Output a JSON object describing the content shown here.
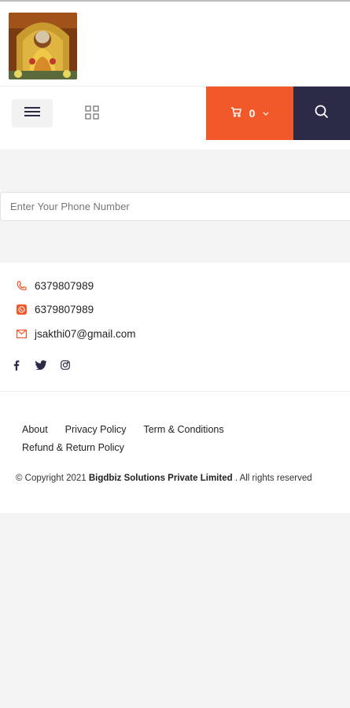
{
  "header": {
    "logo_alt": "Temple deity logo",
    "cart_count": "0"
  },
  "icons": {
    "menu": "hamburger-icon",
    "grid": "grid-icon",
    "cart": "cart-icon",
    "dropdown": "chevron-down-icon",
    "search": "search-icon"
  },
  "colors": {
    "cart_bg": "#f2592a",
    "search_bg": "#2b2b47",
    "accent": "#f2592a"
  },
  "subscribe": {
    "placeholder": "Enter Your Phone Number"
  },
  "contact": {
    "phone": "6379807989",
    "whatsapp": "6379807989",
    "email": "jsakthi07@gmail.com"
  },
  "social": [
    "facebook-icon",
    "twitter-icon",
    "instagram-icon"
  ],
  "footer_links": {
    "about": "About",
    "privacy": "Privacy Policy",
    "terms": "Term & Conditions",
    "refund": "Refund & Return Policy"
  },
  "copyright": {
    "prefix": "© Copyright 2021",
    "company": "Bigdbiz Solutions Private Limited",
    "suffix": ". All rights reserved"
  }
}
